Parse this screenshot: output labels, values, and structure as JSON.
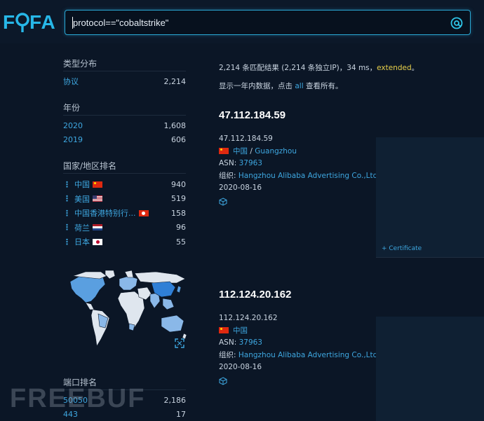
{
  "header": {
    "logo_text": "FOFA",
    "search_query": "protocol==\"cobaltstrike\"",
    "search_icon": "search-at-icon"
  },
  "sidebar": {
    "type_title": "类型分布",
    "types": [
      {
        "label": "协议",
        "count": "2,214"
      }
    ],
    "year_title": "年份",
    "years": [
      {
        "label": "2020",
        "count": "1,608"
      },
      {
        "label": "2019",
        "count": "606"
      }
    ],
    "country_title": "国家/地区排名",
    "countries": [
      {
        "label": "中国",
        "count": "940",
        "flag": "cn"
      },
      {
        "label": "美国",
        "count": "519",
        "flag": "us"
      },
      {
        "label": "中国香港特别行...",
        "count": "158",
        "flag": "hk"
      },
      {
        "label": "荷兰",
        "count": "96",
        "flag": "nl"
      },
      {
        "label": "日本",
        "count": "55",
        "flag": "jp"
      }
    ],
    "port_title": "端口排名",
    "ports": [
      {
        "label": "50050",
        "count": "2,186"
      },
      {
        "label": "443",
        "count": "17"
      }
    ]
  },
  "summary": {
    "text": "2,214 条匹配结果 (2,214 条独立IP)，34 ms，",
    "extended": "extended",
    "end": "。",
    "show_prefix": "显示一年内数据，点击 ",
    "all": "all",
    "show_suffix": " 查看所有。"
  },
  "results": [
    {
      "title": "47.112.184.59",
      "link": "47.112.184.59",
      "country": "中国",
      "sep": " / ",
      "city": "Guangzhou",
      "asn_label": "ASN: ",
      "asn": "37963",
      "org_label": "组织: ",
      "org": "Hangzhou Alibaba Advertising Co.,Ltd.",
      "date": "2020-08-16"
    },
    {
      "title": "112.124.20.162",
      "link": "112.124.20.162",
      "country": "中国",
      "asn_label": "ASN: ",
      "asn": "37963",
      "org_label": "组织: ",
      "org": "Hangzhou Alibaba Advertising Co.,Ltd.",
      "date": "2020-08-16"
    }
  ],
  "certificate_label": "+ Certificate",
  "watermark": "FREEBUF",
  "colors": {
    "accent": "#3ea7e0",
    "background": "#0b1626",
    "extended": "#e8d04a"
  }
}
